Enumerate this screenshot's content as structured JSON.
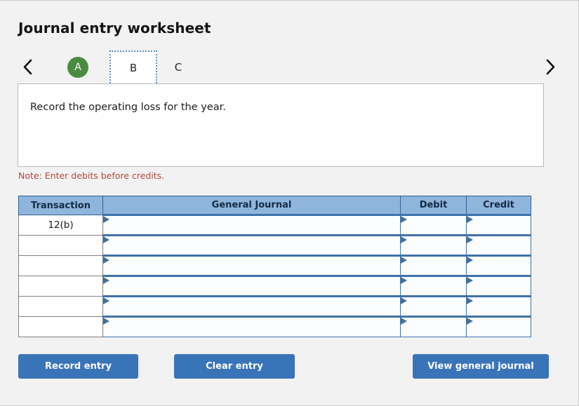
{
  "header": {
    "title": "Journal entry worksheet"
  },
  "tabs": {
    "prev_icon": "chevron-left-icon",
    "next_icon": "chevron-right-icon",
    "items": [
      {
        "label": "A",
        "state": "completed"
      },
      {
        "label": "B",
        "state": "selected"
      },
      {
        "label": "C",
        "state": "default"
      }
    ]
  },
  "description": {
    "text": "Record the operating loss for the year."
  },
  "note": {
    "text": "Note: Enter debits before credits.",
    "color": "#b5483e"
  },
  "table": {
    "headers": {
      "transaction": "Transaction",
      "general_journal": "General Journal",
      "debit": "Debit",
      "credit": "Credit"
    },
    "header_bg": "#90b5dd",
    "rows": [
      {
        "transaction": "12(b)",
        "general_journal": "",
        "debit": "",
        "credit": ""
      },
      {
        "transaction": "",
        "general_journal": "",
        "debit": "",
        "credit": ""
      },
      {
        "transaction": "",
        "general_journal": "",
        "debit": "",
        "credit": ""
      },
      {
        "transaction": "",
        "general_journal": "",
        "debit": "",
        "credit": ""
      },
      {
        "transaction": "",
        "general_journal": "",
        "debit": "",
        "credit": ""
      },
      {
        "transaction": "",
        "general_journal": "",
        "debit": "",
        "credit": ""
      }
    ]
  },
  "buttons": {
    "record_entry": "Record entry",
    "clear_entry": "Clear entry",
    "view_general_journal": "View general journal",
    "color": "#3a74b8"
  }
}
